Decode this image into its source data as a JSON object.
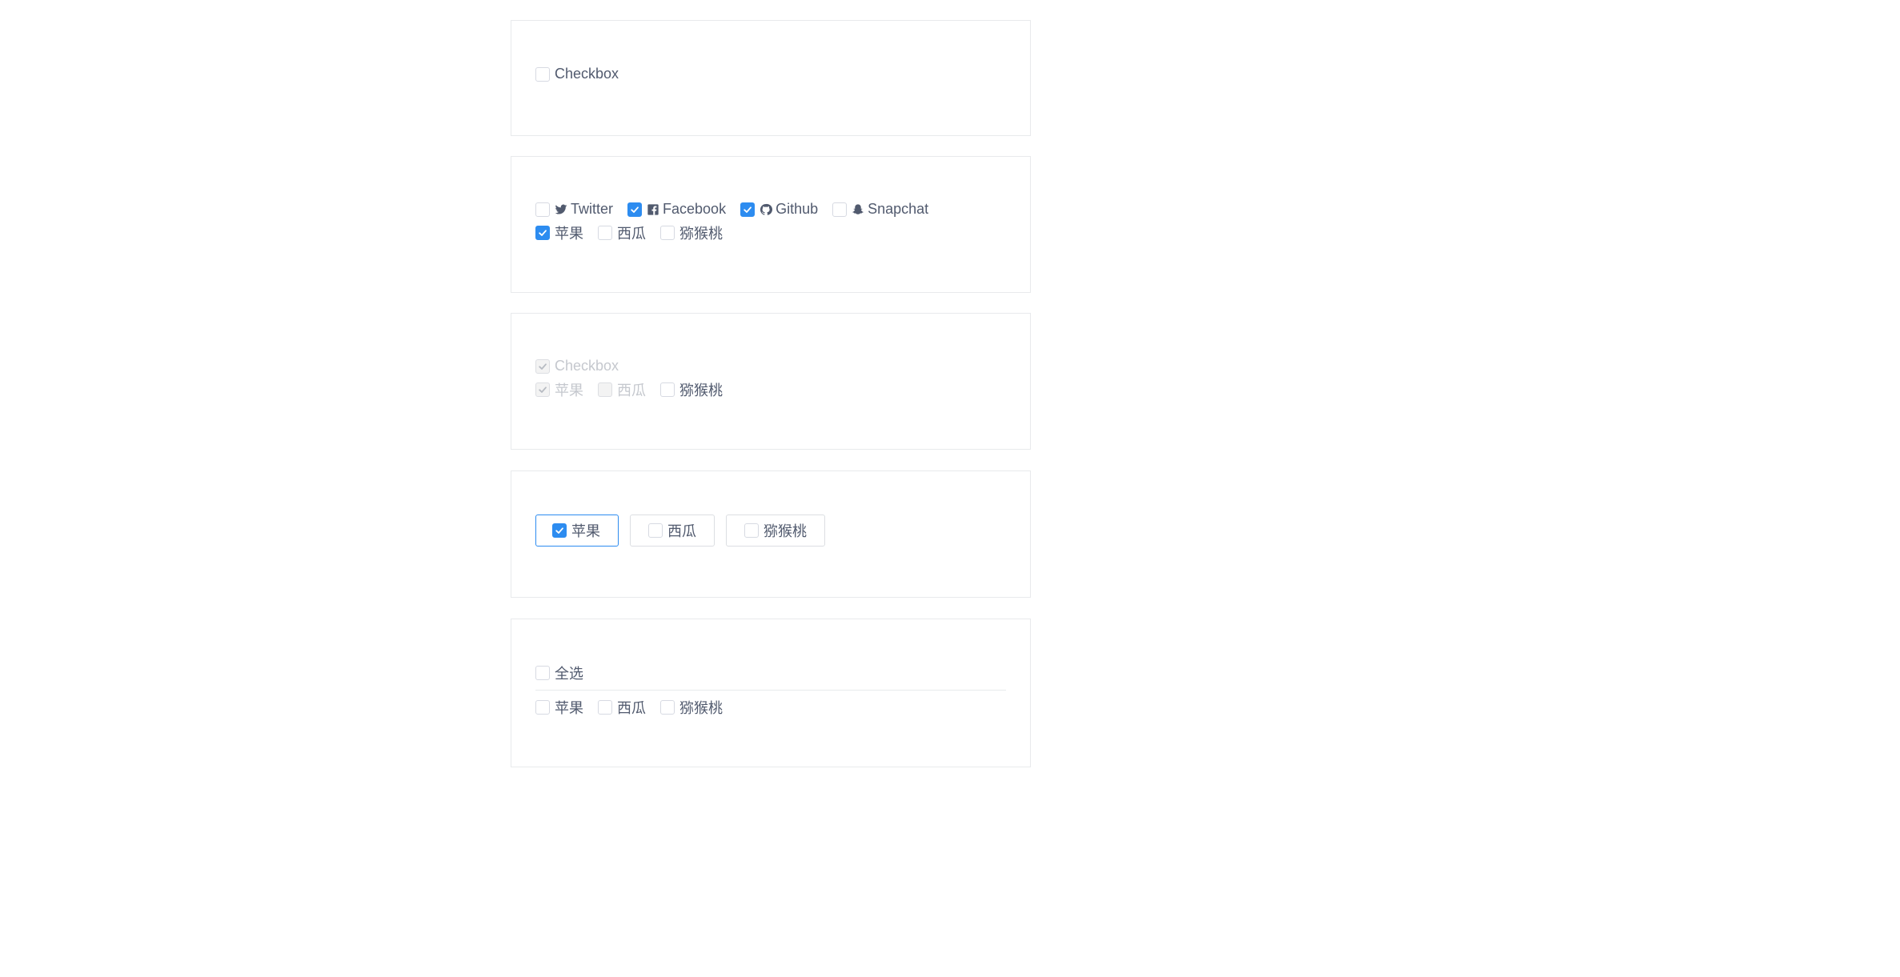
{
  "single": {
    "label": "Checkbox",
    "checked": false
  },
  "social": [
    {
      "label": "Twitter",
      "icon": "twitter-icon",
      "checked": false
    },
    {
      "label": "Facebook",
      "icon": "facebook-icon",
      "checked": true
    },
    {
      "label": "Github",
      "icon": "github-icon",
      "checked": true
    },
    {
      "label": "Snapchat",
      "icon": "snapchat-icon",
      "checked": false
    }
  ],
  "fruit_group": [
    {
      "label": "苹果",
      "checked": true
    },
    {
      "label": "西瓜",
      "checked": false
    },
    {
      "label": "猕猴桃",
      "checked": false
    }
  ],
  "disabled_single": {
    "label": "Checkbox",
    "checked": true,
    "disabled": true
  },
  "disabled_group": [
    {
      "label": "苹果",
      "checked": true,
      "disabled": true
    },
    {
      "label": "西瓜",
      "checked": false,
      "disabled": true
    },
    {
      "label": "猕猴桃",
      "checked": false,
      "disabled": false
    }
  ],
  "border_group": [
    {
      "label": "苹果",
      "checked": true
    },
    {
      "label": "西瓜",
      "checked": false
    },
    {
      "label": "猕猴桃",
      "checked": false
    }
  ],
  "check_all": {
    "label": "全选",
    "checked": false
  },
  "check_all_group": [
    {
      "label": "苹果",
      "checked": false
    },
    {
      "label": "西瓜",
      "checked": false
    },
    {
      "label": "猕猴桃",
      "checked": false
    }
  ],
  "colors": {
    "accent": "#2d8cf0",
    "border": "#dcdee2",
    "text": "#515a6e",
    "disabled_text": "#c5c8ce"
  }
}
